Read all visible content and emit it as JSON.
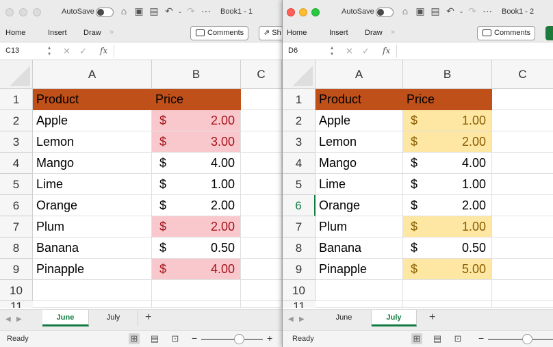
{
  "colors": {
    "header_fill": "#c0501a",
    "book1_highlight": "#f9c8cd",
    "book1_highlight_text": "#a4141a",
    "book2_highlight": "#fde7a3",
    "book2_highlight_text": "#8a5d00",
    "excel_green": "#107c41"
  },
  "left": {
    "title": {
      "autosave": "AutoSave",
      "book": "Book1 - 1"
    },
    "ribbon": {
      "home": "Home",
      "insert": "Insert",
      "draw": "Draw",
      "more": "»",
      "comments": "Comments",
      "share": "Sh"
    },
    "formula_bar": {
      "cell_ref": "C13",
      "fx": "fx"
    },
    "columns": [
      "A",
      "B",
      "C"
    ],
    "rows": [
      "1",
      "2",
      "3",
      "4",
      "5",
      "6",
      "7",
      "8",
      "9",
      "10",
      "11"
    ],
    "header": {
      "product": "Product",
      "price": "Price"
    },
    "data": [
      {
        "product": "Apple",
        "currency": "$",
        "amount": "2.00",
        "highlight": true
      },
      {
        "product": "Lemon",
        "currency": "$",
        "amount": "3.00",
        "highlight": true
      },
      {
        "product": "Mango",
        "currency": "$",
        "amount": "4.00",
        "highlight": false
      },
      {
        "product": "Lime",
        "currency": "$",
        "amount": "1.00",
        "highlight": false
      },
      {
        "product": "Orange",
        "currency": "$",
        "amount": "2.00",
        "highlight": false
      },
      {
        "product": "Plum",
        "currency": "$",
        "amount": "2.00",
        "highlight": true
      },
      {
        "product": "Banana",
        "currency": "$",
        "amount": "0.50",
        "highlight": false
      },
      {
        "product": "Pinapple",
        "currency": "$",
        "amount": "4.00",
        "highlight": true
      }
    ],
    "sheets": [
      "June",
      "July"
    ],
    "active_sheet": "June",
    "status": "Ready",
    "zoom_partial": "+"
  },
  "right": {
    "title": {
      "autosave": "AutoSave",
      "book": "Book1 - 2"
    },
    "ribbon": {
      "home": "Home",
      "insert": "Insert",
      "draw": "Draw",
      "more": "»",
      "comments": "Comments"
    },
    "formula_bar": {
      "cell_ref": "D6",
      "fx": "fx"
    },
    "columns": [
      "A",
      "B",
      "C"
    ],
    "rows": [
      "1",
      "2",
      "3",
      "4",
      "5",
      "6",
      "7",
      "8",
      "9",
      "10",
      "11"
    ],
    "active_row": "6",
    "header": {
      "product": "Product",
      "price": "Price"
    },
    "data": [
      {
        "product": "Apple",
        "currency": "$",
        "amount": "1.00",
        "highlight": true
      },
      {
        "product": "Lemon",
        "currency": "$",
        "amount": "2.00",
        "highlight": true
      },
      {
        "product": "Mango",
        "currency": "$",
        "amount": "4.00",
        "highlight": false
      },
      {
        "product": "Lime",
        "currency": "$",
        "amount": "1.00",
        "highlight": false
      },
      {
        "product": "Orange",
        "currency": "$",
        "amount": "2.00",
        "highlight": false
      },
      {
        "product": "Plum",
        "currency": "$",
        "amount": "1.00",
        "highlight": true
      },
      {
        "product": "Banana",
        "currency": "$",
        "amount": "0.50",
        "highlight": false
      },
      {
        "product": "Pinapple",
        "currency": "$",
        "amount": "5.00",
        "highlight": true
      }
    ],
    "sheets": [
      "June",
      "July"
    ],
    "active_sheet": "July",
    "status": "Ready"
  }
}
